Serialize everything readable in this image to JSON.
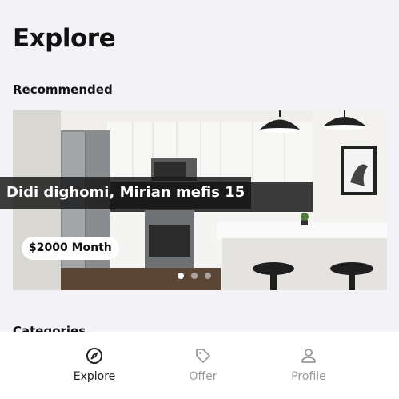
{
  "page": {
    "title": "Explore"
  },
  "sections": {
    "recommended": {
      "title": "Recommended"
    },
    "next": {
      "title": "Categories"
    }
  },
  "card": {
    "address": "Didi dighomi, Mirian mefis 15",
    "price": "$2000 Month",
    "slides": 3,
    "active_slide": 1
  },
  "tabs": [
    {
      "label": "Explore",
      "icon": "compass-icon",
      "active": true
    },
    {
      "label": "Offer",
      "icon": "tag-icon",
      "active": false
    },
    {
      "label": "Profile",
      "icon": "person-icon",
      "active": false
    }
  ],
  "colors": {
    "active_tab": "#222222",
    "inactive_tab": "#9a9a9a",
    "background": "#f2f2f7"
  }
}
